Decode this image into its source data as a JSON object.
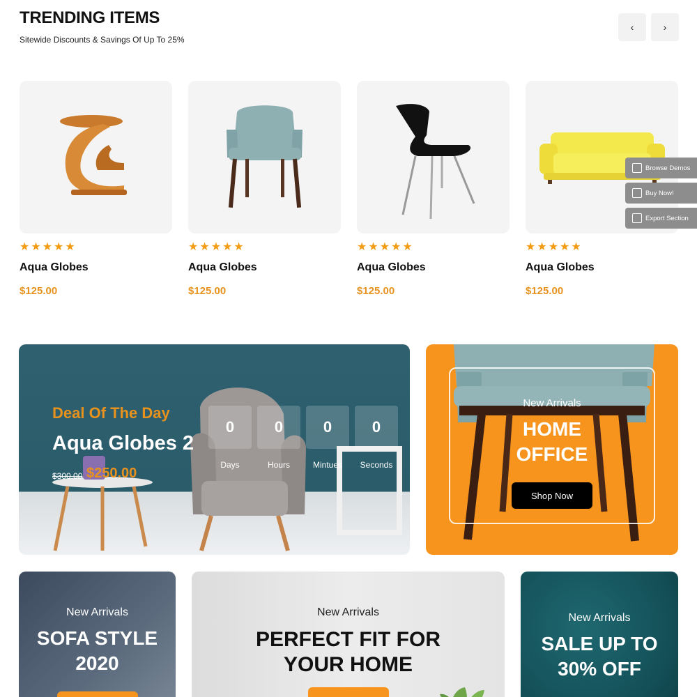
{
  "trending": {
    "title": "TRENDING ITEMS",
    "subtitle": "Sitewide Discounts & Savings Of Up To 25%",
    "prev_icon": "‹",
    "next_icon": "›"
  },
  "products": [
    {
      "name": "Aqua Globes",
      "price": "$125.00",
      "rating": 5,
      "image": "wooden-side-table"
    },
    {
      "name": "Aqua Globes",
      "price": "$125.00",
      "rating": 5,
      "image": "teal-armchair"
    },
    {
      "name": "Aqua Globes",
      "price": "$125.00",
      "rating": 5,
      "image": "black-chair"
    },
    {
      "name": "Aqua Globes",
      "price": "$125.00",
      "rating": 5,
      "image": "yellow-sofa"
    }
  ],
  "float_menu": [
    {
      "label": "Browse Demos",
      "icon": "grid-icon"
    },
    {
      "label": "Buy Now!",
      "icon": "bag-icon"
    },
    {
      "label": "Export Section",
      "icon": "export-icon"
    }
  ],
  "deal": {
    "label": "Deal Of The Day",
    "title": "Aqua Globes 2",
    "old_price": "$300.00",
    "new_price": "$250.00",
    "countdown": [
      {
        "value": "0",
        "label": "Days"
      },
      {
        "value": "0",
        "label": "Hours"
      },
      {
        "value": "0",
        "label": "Mintues"
      },
      {
        "value": "0",
        "label": "Seconds"
      }
    ]
  },
  "office": {
    "kicker": "New Arrivals",
    "title_line1": "HOME",
    "title_line2": "OFFICE",
    "button": "Shop Now"
  },
  "promos": {
    "sofa": {
      "kicker": "New Arrivals",
      "line1": "SOFA STYLE",
      "line2": "2020"
    },
    "fit": {
      "kicker": "New Arrivals",
      "line1": "PERFECT FIT FOR",
      "line2": "YOUR HOME"
    },
    "sale": {
      "kicker": "New Arrivals",
      "line1": "SALE UP TO",
      "line2": "30% OFF"
    }
  },
  "colors": {
    "accent": "#f7941d",
    "price": "#e8921e",
    "star": "#f39c12"
  }
}
